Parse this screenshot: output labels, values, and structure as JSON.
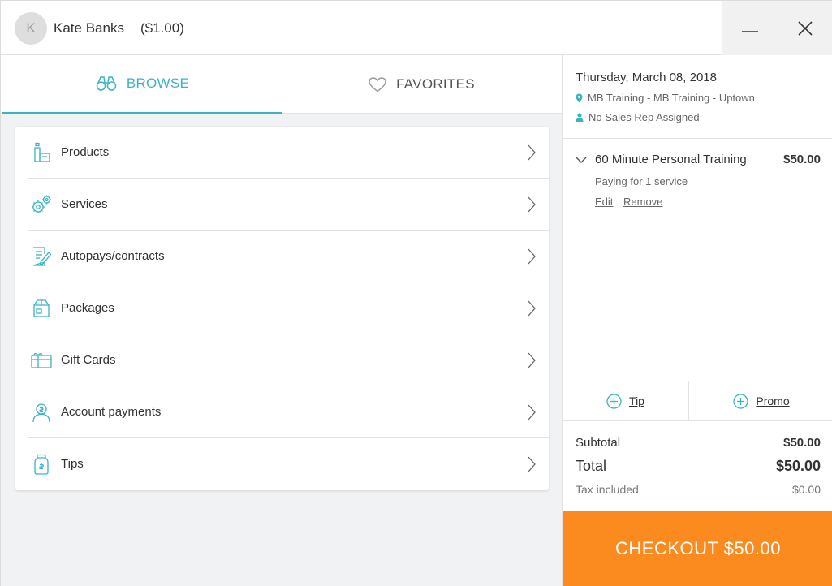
{
  "colors": {
    "accent": "#3ab4c3",
    "checkout": "#fb8b1e",
    "panel_bg": "#f1f2f3",
    "text": "#333333"
  },
  "header": {
    "avatar_initial": "K",
    "client_name": "Kate Banks",
    "client_balance": "($1.00)",
    "minimize_icon": "minimize-icon",
    "close_icon": "close-icon"
  },
  "tabs": [
    {
      "label": "BROWSE",
      "icon": "binoculars-icon",
      "active": true
    },
    {
      "label": "FAVORITES",
      "icon": "heart-icon",
      "active": false
    }
  ],
  "browse_items": [
    {
      "label": "Products",
      "icon": "products-icon"
    },
    {
      "label": "Services",
      "icon": "gears-icon"
    },
    {
      "label": "Autopays/contracts",
      "icon": "contract-icon"
    },
    {
      "label": "Packages",
      "icon": "package-icon"
    },
    {
      "label": "Gift Cards",
      "icon": "gift-card-icon"
    },
    {
      "label": "Account payments",
      "icon": "account-icon"
    },
    {
      "label": "Tips",
      "icon": "tip-jar-icon"
    }
  ],
  "cart": {
    "date": "Thursday, March 08, 2018",
    "location": "MB Training - MB Training - Uptown",
    "sales_rep": "No Sales Rep Assigned",
    "items": [
      {
        "name": "60 Minute Personal Training",
        "price": "$50.00",
        "subtitle": "Paying for 1 service",
        "edit_label": "Edit",
        "remove_label": "Remove"
      }
    ],
    "tip_label": "Tip",
    "promo_label": "Promo",
    "subtotal_label": "Subtotal",
    "subtotal_value": "$50.00",
    "total_label": "Total",
    "total_value": "$50.00",
    "tax_label": "Tax included",
    "tax_value": "$0.00",
    "checkout_label": "CHECKOUT $50.00"
  }
}
